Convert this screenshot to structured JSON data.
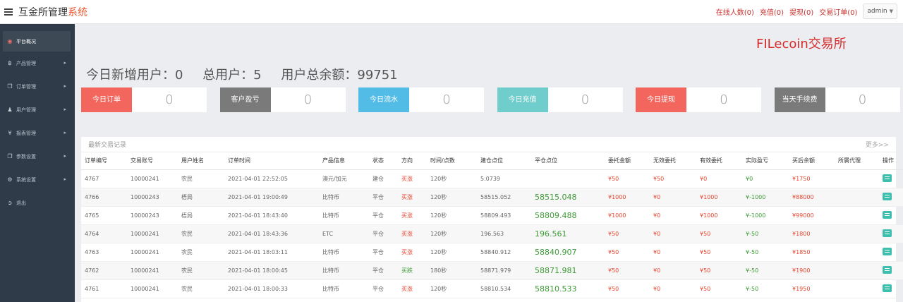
{
  "header": {
    "title_main": "互金所管理",
    "title_sub": "系统",
    "links": [
      "在线人数(0)",
      "充值(0)",
      "提现(0)",
      "交易订单(0)"
    ],
    "user": "admin"
  },
  "sidebar": {
    "items": [
      {
        "label": "平台概况",
        "icon": "dashboard-icon",
        "glyph": "◉"
      },
      {
        "label": "产品管理",
        "icon": "bitcoin-icon",
        "glyph": "฿"
      },
      {
        "label": "订单管理",
        "icon": "copy-icon",
        "glyph": "❐"
      },
      {
        "label": "用户管理",
        "icon": "user-icon",
        "glyph": "♟"
      },
      {
        "label": "报表管理",
        "icon": "yen-icon",
        "glyph": "¥"
      },
      {
        "label": "参数设置",
        "icon": "copy-icon",
        "glyph": "❐"
      },
      {
        "label": "系统设置",
        "icon": "cogs-icon",
        "glyph": "⚙"
      },
      {
        "label": "退出",
        "icon": "sign-out-icon",
        "glyph": "➲"
      }
    ]
  },
  "main": {
    "exchange_title": "FILecoin交易所",
    "stats": {
      "new_users": "今日新增用户：0",
      "total_users": "总用户：5",
      "total_balance": "用户总余额：99751"
    },
    "cards": [
      {
        "line1": "今日",
        "line2": "订单",
        "value": "0",
        "color": "#f2665e"
      },
      {
        "line1": "客户",
        "line2": "盈亏",
        "value": "0",
        "color": "#7a7a7a"
      },
      {
        "line1": "今日",
        "line2": "流水",
        "value": "0",
        "color": "#53bce6"
      },
      {
        "line1": "今日",
        "line2": "充值",
        "value": "0",
        "color": "#6fcdcb"
      },
      {
        "line1": "今日",
        "line2": "提现",
        "value": "0",
        "color": "#f2665e"
      },
      {
        "line1": "当天",
        "line2": "手续费",
        "value": "0",
        "color": "#7a7a7a"
      }
    ],
    "table_title": "最新交易记录",
    "more": "更多>>",
    "columns": [
      "订单编号",
      "交易账号",
      "用户姓名",
      "订单时间",
      "产品信息",
      "状态",
      "方向",
      "时间/点数",
      "建仓点位",
      "平仓点位",
      "委托金额",
      "无效委托",
      "有效委托",
      "实际盈亏",
      "买后余额",
      "所属代理",
      "操作"
    ],
    "rows": [
      [
        "4767",
        "10000241",
        "农民",
        "2021-04-01 22:52:05",
        "澳元/加元",
        "建仓",
        "买涨",
        "120秒",
        "5.0739",
        "",
        "¥50",
        "¥50",
        "¥0",
        "¥0",
        "¥1750",
        ""
      ],
      [
        "4766",
        "10000243",
        "梧局",
        "2021-04-01 19:00:49",
        "比特币",
        "平仓",
        "买涨",
        "120秒",
        "58515.052",
        "58515.048",
        "¥1000",
        "¥0",
        "¥1000",
        "¥-1000",
        "¥88000",
        ""
      ],
      [
        "4765",
        "10000243",
        "梧局",
        "2021-04-01 18:43:40",
        "比特币",
        "平仓",
        "买涨",
        "120秒",
        "58809.493",
        "58809.488",
        "¥1000",
        "¥0",
        "¥1000",
        "¥-1000",
        "¥99000",
        ""
      ],
      [
        "4764",
        "10000241",
        "农民",
        "2021-04-01 18:43:36",
        "ETC",
        "平仓",
        "买涨",
        "120秒",
        "196.563",
        "196.561",
        "¥50",
        "¥0",
        "¥50",
        "¥-50",
        "¥1800",
        ""
      ],
      [
        "4763",
        "10000241",
        "农民",
        "2021-04-01 18:03:11",
        "比特币",
        "平仓",
        "买涨",
        "120秒",
        "58840.912",
        "58840.907",
        "¥50",
        "¥0",
        "¥50",
        "¥-50",
        "¥1850",
        ""
      ],
      [
        "4762",
        "10000241",
        "农民",
        "2021-04-01 18:00:45",
        "比特币",
        "平仓",
        "买跌",
        "180秒",
        "58871.979",
        "58871.981",
        "¥50",
        "¥0",
        "¥50",
        "¥-50",
        "¥1900",
        ""
      ],
      [
        "4761",
        "10000241",
        "农民",
        "2021-04-01 18:00:33",
        "比特币",
        "平仓",
        "买涨",
        "120秒",
        "58810.534",
        "58810.533",
        "¥50",
        "¥0",
        "¥50",
        "¥-50",
        "¥1950",
        ""
      ]
    ]
  }
}
